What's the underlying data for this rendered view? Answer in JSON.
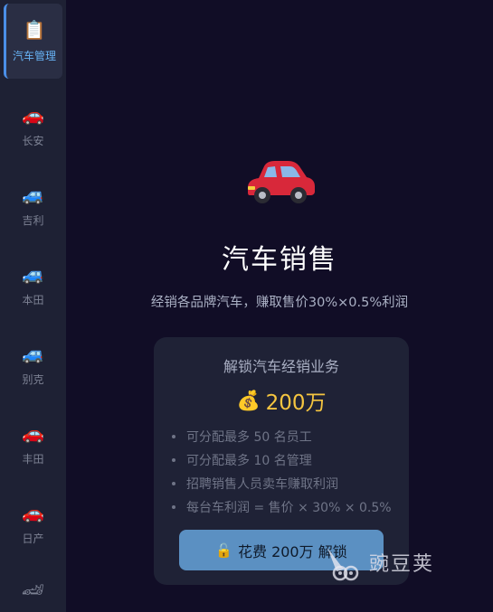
{
  "sidebar": {
    "items": [
      {
        "icon": "clipboard-icon",
        "glyph": "📋",
        "label": "汽车管理",
        "active": true
      },
      {
        "icon": "red-car-icon",
        "glyph": "🚗",
        "label": "长安"
      },
      {
        "icon": "blue-car-icon",
        "glyph": "🚙",
        "label": "吉利"
      },
      {
        "icon": "blue-car-icon",
        "glyph": "🚙",
        "label": "本田"
      },
      {
        "icon": "blue-car-icon",
        "glyph": "🚙",
        "label": "别克"
      },
      {
        "icon": "red-car-icon",
        "glyph": "🚗",
        "label": "丰田"
      },
      {
        "icon": "red-car-icon",
        "glyph": "🚗",
        "label": "日产"
      },
      {
        "icon": "race-car-icon",
        "glyph": "🏎",
        "label": ""
      }
    ]
  },
  "main": {
    "icon": "red-car-icon",
    "title": "汽车销售",
    "subtitle": "经销各品牌汽车，赚取售价30%×0.5%利润",
    "card": {
      "title": "解锁汽车经销业务",
      "price_icon": "money-bag-icon",
      "price_glyph": "💰",
      "price": "200万",
      "bullets": [
        "可分配最多 50 名员工",
        "可分配最多 10 名管理",
        "招聘销售人员卖车赚取利润",
        "每台车利润 = 售价 × 30% × 0.5%"
      ],
      "button_icon": "lock-icon",
      "button_glyph": "🔓",
      "button_label": "花费 200万 解锁"
    }
  },
  "watermark": {
    "text": "豌豆荚"
  },
  "colors": {
    "background": "#110d26",
    "sidebar": "#1e2134",
    "active_text": "#67b3f6",
    "price": "#f5c540",
    "button": "#5b90c2"
  }
}
